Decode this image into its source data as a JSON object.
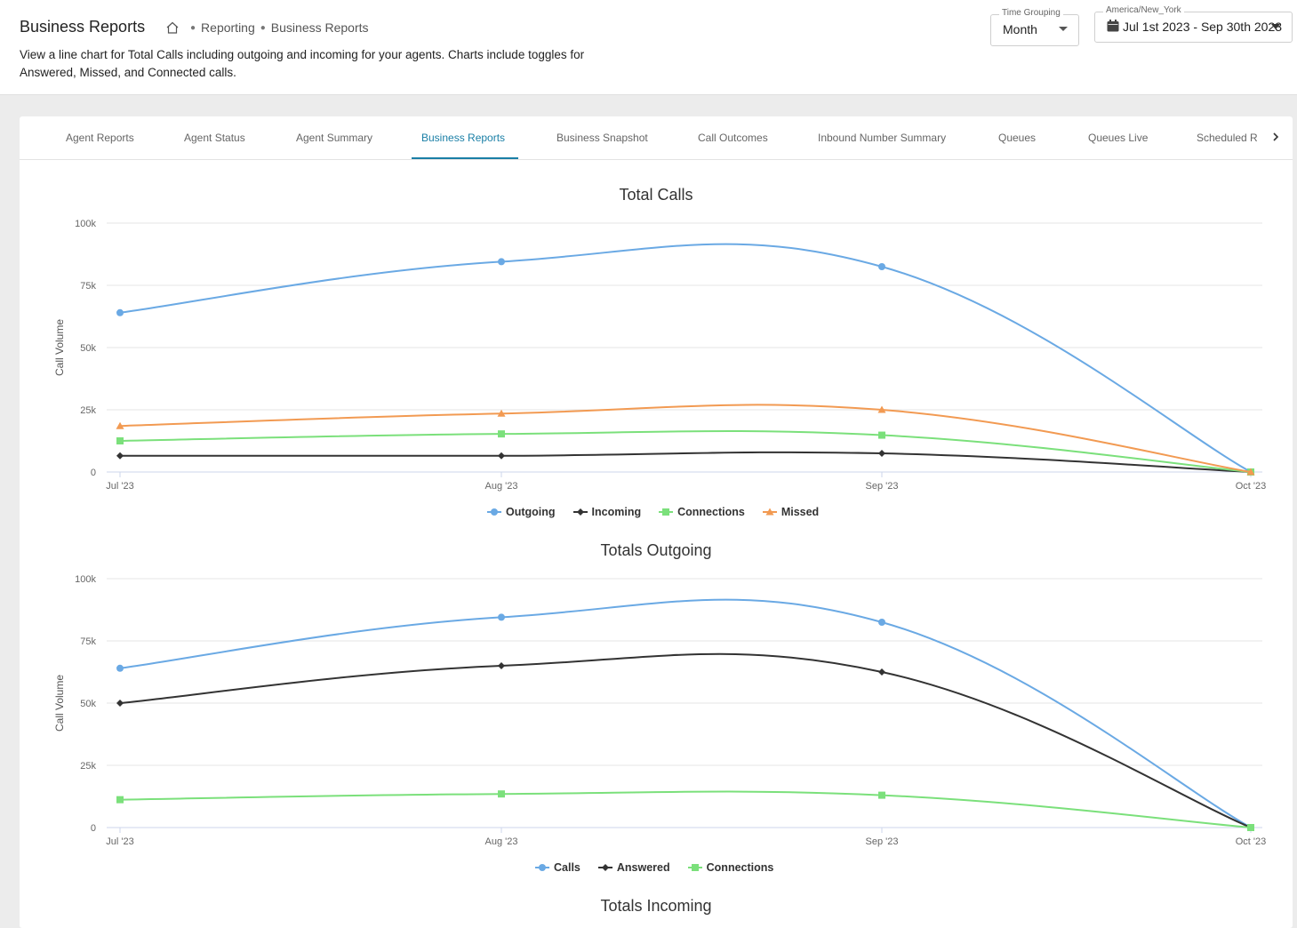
{
  "header": {
    "title": "Business Reports",
    "breadcrumb": [
      "Reporting",
      "Business Reports"
    ],
    "description": "View a line chart for Total Calls including outgoing and incoming for your agents. Charts include toggles for Answered, Missed, and Connected calls.",
    "time_grouping": {
      "label": "Time Grouping",
      "value": "Month"
    },
    "date_range": {
      "label": "America/New_York",
      "value": "Jul 1st 2023 - Sep 30th 2023"
    }
  },
  "tabs": [
    {
      "label": "Agent Reports"
    },
    {
      "label": "Agent Status"
    },
    {
      "label": "Agent Summary"
    },
    {
      "label": "Business Reports",
      "active": true
    },
    {
      "label": "Business Snapshot"
    },
    {
      "label": "Call Outcomes"
    },
    {
      "label": "Inbound Number Summary"
    },
    {
      "label": "Queues"
    },
    {
      "label": "Queues Live"
    },
    {
      "label": "Scheduled R"
    }
  ],
  "colors": {
    "blue": "#6aa9e4",
    "black": "#333333",
    "green": "#7be07b",
    "orange": "#f29a52",
    "accent": "#1a7fa6"
  },
  "chart_data": [
    {
      "type": "line",
      "title": "Total Calls",
      "ylabel": "Call Volume",
      "x": [
        "Jul '23",
        "Aug '23",
        "Sep '23",
        "Oct '23"
      ],
      "ylim": [
        0,
        100000
      ],
      "yticks": [
        "0",
        "25k",
        "50k",
        "75k",
        "100k"
      ],
      "grid": true,
      "legend_position": "bottom",
      "series": [
        {
          "name": "Outgoing",
          "values": [
            64000,
            84500,
            82500,
            0
          ],
          "color": "#6aa9e4",
          "marker": "circle"
        },
        {
          "name": "Incoming",
          "values": [
            6500,
            6500,
            7500,
            0
          ],
          "color": "#333333",
          "marker": "diamond"
        },
        {
          "name": "Connections",
          "values": [
            12500,
            15300,
            14800,
            0
          ],
          "color": "#7be07b",
          "marker": "square"
        },
        {
          "name": "Missed",
          "values": [
            18500,
            23500,
            25000,
            0
          ],
          "color": "#f29a52",
          "marker": "triangle"
        }
      ]
    },
    {
      "type": "line",
      "title": "Totals Outgoing",
      "ylabel": "Call Volume",
      "x": [
        "Jul '23",
        "Aug '23",
        "Sep '23",
        "Oct '23"
      ],
      "ylim": [
        0,
        100000
      ],
      "yticks": [
        "0",
        "25k",
        "50k",
        "75k",
        "100k"
      ],
      "grid": true,
      "legend_position": "bottom",
      "series": [
        {
          "name": "Calls",
          "values": [
            64000,
            84500,
            82500,
            0
          ],
          "color": "#6aa9e4",
          "marker": "circle"
        },
        {
          "name": "Answered",
          "values": [
            50000,
            65000,
            62500,
            0
          ],
          "color": "#333333",
          "marker": "diamond"
        },
        {
          "name": "Connections",
          "values": [
            11200,
            13500,
            13000,
            0
          ],
          "color": "#7be07b",
          "marker": "square"
        }
      ]
    },
    {
      "type": "line",
      "title": "Totals Incoming",
      "x": [],
      "series": []
    }
  ]
}
